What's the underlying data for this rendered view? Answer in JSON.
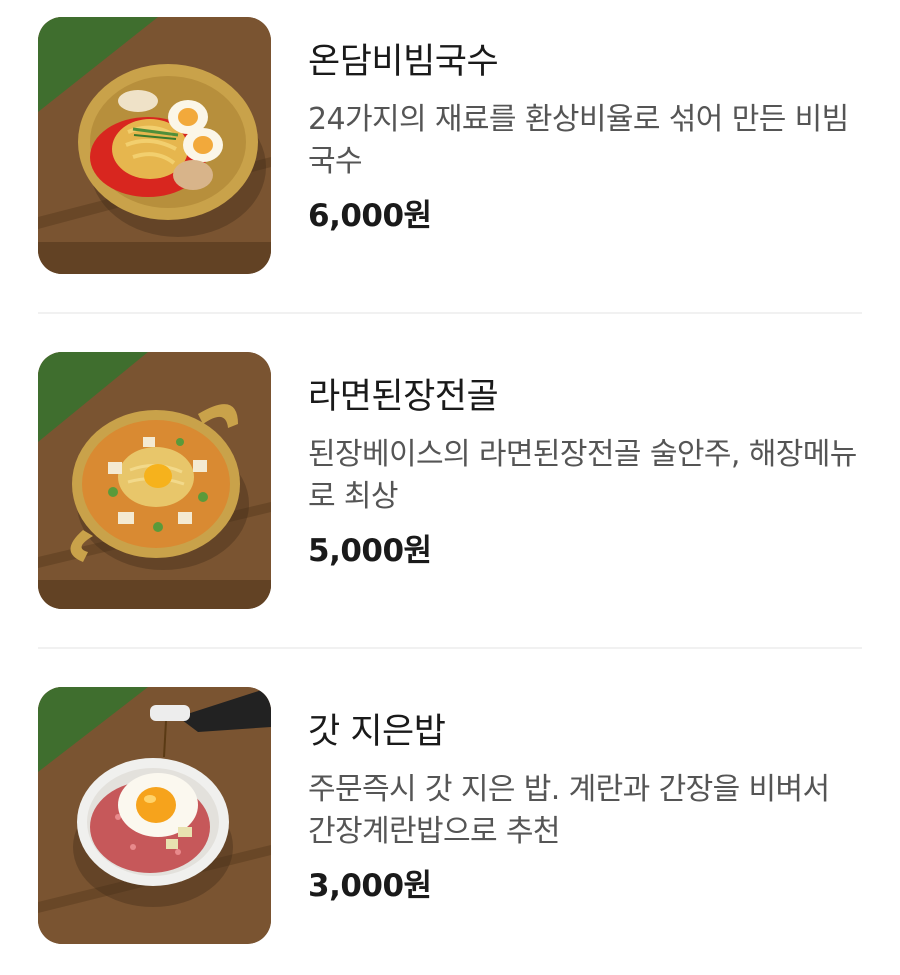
{
  "menu": {
    "items": [
      {
        "name": "온담비빔국수",
        "description": "24가지의 재료를 환상비율로 섞어 만든 비빔국수",
        "price": "6,000원",
        "image_icon": "bibim-noodles-photo"
      },
      {
        "name": "라면된장전골",
        "description": "된장베이스의 라면된장전골 술안주, 해장메뉴로 최상",
        "price": "5,000원",
        "image_icon": "ramen-doenjang-stew-photo"
      },
      {
        "name": "갓 지은밥",
        "description": "주문즉시 갓 지은 밥. 계란과 간장을 비벼서 간장계란밥으로 추천",
        "price": "3,000원",
        "image_icon": "egg-rice-bowl-photo"
      }
    ]
  },
  "colors": {
    "wood": "#7a5431",
    "grass": "#3f6e2e",
    "brass": "#c9a24a",
    "text_primary": "#1a1a1a",
    "text_secondary": "#555555",
    "divider": "#f1f1f1"
  }
}
